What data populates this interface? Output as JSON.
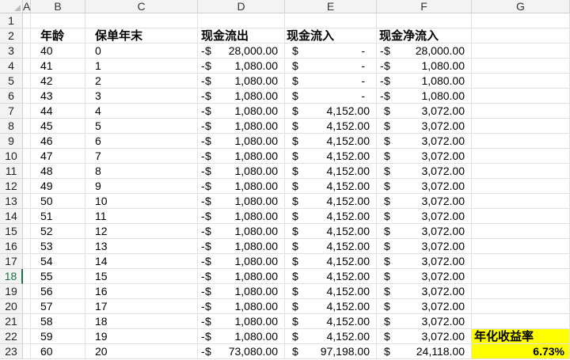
{
  "spreadsheet": {
    "columns": [
      "A",
      "B",
      "C",
      "D",
      "E",
      "F",
      "G"
    ],
    "header_row": {
      "row_number": "2",
      "age": "年龄",
      "policy_year_end": "保单年末",
      "cash_outflow": "现金流出",
      "cash_inflow": "现金流入",
      "net_cash_inflow": "现金净流入"
    },
    "selected_row": "18",
    "currency_symbol": "$",
    "negative_sign": "-",
    "zero_placeholder": "-",
    "rows": [
      {
        "row": "3",
        "age": "40",
        "year": "0",
        "outflow": "28,000.00",
        "inflow": "",
        "net": "28,000.00",
        "net_negative": true
      },
      {
        "row": "4",
        "age": "41",
        "year": "1",
        "outflow": "1,080.00",
        "inflow": "",
        "net": "1,080.00",
        "net_negative": true
      },
      {
        "row": "5",
        "age": "42",
        "year": "2",
        "outflow": "1,080.00",
        "inflow": "",
        "net": "1,080.00",
        "net_negative": true
      },
      {
        "row": "6",
        "age": "43",
        "year": "3",
        "outflow": "1,080.00",
        "inflow": "",
        "net": "1,080.00",
        "net_negative": true
      },
      {
        "row": "7",
        "age": "44",
        "year": "4",
        "outflow": "1,080.00",
        "inflow": "4,152.00",
        "net": "3,072.00",
        "net_negative": false
      },
      {
        "row": "8",
        "age": "45",
        "year": "5",
        "outflow": "1,080.00",
        "inflow": "4,152.00",
        "net": "3,072.00",
        "net_negative": false
      },
      {
        "row": "9",
        "age": "46",
        "year": "6",
        "outflow": "1,080.00",
        "inflow": "4,152.00",
        "net": "3,072.00",
        "net_negative": false
      },
      {
        "row": "10",
        "age": "47",
        "year": "7",
        "outflow": "1,080.00",
        "inflow": "4,152.00",
        "net": "3,072.00",
        "net_negative": false
      },
      {
        "row": "11",
        "age": "48",
        "year": "8",
        "outflow": "1,080.00",
        "inflow": "4,152.00",
        "net": "3,072.00",
        "net_negative": false
      },
      {
        "row": "12",
        "age": "49",
        "year": "9",
        "outflow": "1,080.00",
        "inflow": "4,152.00",
        "net": "3,072.00",
        "net_negative": false
      },
      {
        "row": "13",
        "age": "50",
        "year": "10",
        "outflow": "1,080.00",
        "inflow": "4,152.00",
        "net": "3,072.00",
        "net_negative": false
      },
      {
        "row": "14",
        "age": "51",
        "year": "11",
        "outflow": "1,080.00",
        "inflow": "4,152.00",
        "net": "3,072.00",
        "net_negative": false
      },
      {
        "row": "15",
        "age": "52",
        "year": "12",
        "outflow": "1,080.00",
        "inflow": "4,152.00",
        "net": "3,072.00",
        "net_negative": false
      },
      {
        "row": "16",
        "age": "53",
        "year": "13",
        "outflow": "1,080.00",
        "inflow": "4,152.00",
        "net": "3,072.00",
        "net_negative": false
      },
      {
        "row": "17",
        "age": "54",
        "year": "14",
        "outflow": "1,080.00",
        "inflow": "4,152.00",
        "net": "3,072.00",
        "net_negative": false
      },
      {
        "row": "18",
        "age": "55",
        "year": "15",
        "outflow": "1,080.00",
        "inflow": "4,152.00",
        "net": "3,072.00",
        "net_negative": false
      },
      {
        "row": "19",
        "age": "56",
        "year": "16",
        "outflow": "1,080.00",
        "inflow": "4,152.00",
        "net": "3,072.00",
        "net_negative": false
      },
      {
        "row": "20",
        "age": "57",
        "year": "17",
        "outflow": "1,080.00",
        "inflow": "4,152.00",
        "net": "3,072.00",
        "net_negative": false
      },
      {
        "row": "21",
        "age": "58",
        "year": "18",
        "outflow": "1,080.00",
        "inflow": "4,152.00",
        "net": "3,072.00",
        "net_negative": false
      },
      {
        "row": "22",
        "age": "59",
        "year": "19",
        "outflow": "1,080.00",
        "inflow": "4,152.00",
        "net": "3,072.00",
        "net_negative": false
      },
      {
        "row": "23",
        "age": "60",
        "year": "20",
        "outflow": "73,080.00",
        "inflow": "97,198.00",
        "net": "24,118.00",
        "net_negative": false
      }
    ],
    "summary": {
      "label": "年化收益率",
      "value": "6.73%",
      "highlight_color": "#ffff00"
    },
    "colors": {
      "header_bg": "#f3f3f3",
      "selected_row_accent": "#1e7145",
      "gridline": "#e1e1e1"
    }
  }
}
